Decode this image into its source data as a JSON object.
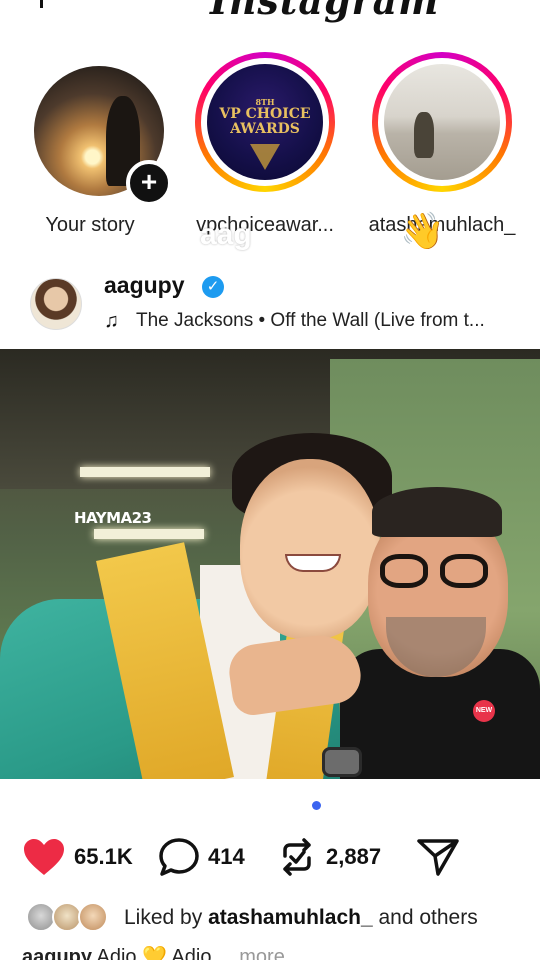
{
  "app": {
    "logo_text": "Instagram"
  },
  "stories": [
    {
      "name": "Your story",
      "has_ring": false,
      "has_add": true,
      "add_symbol": "+"
    },
    {
      "name": "vpchoiceawar...",
      "has_ring": true,
      "avatar_text": {
        "small": "8TH",
        "main": "VP CHOICE AWARDS"
      }
    },
    {
      "name": "atashamuhlach_",
      "has_ring": true
    }
  ],
  "overlay": {
    "text": "aag",
    "emoji": "👋"
  },
  "post": {
    "username": "aagupy",
    "verified": true,
    "verified_symbol": "✓",
    "music_icon": "♫",
    "music": "The Jacksons • Off the Wall (Live from t...",
    "image": {
      "watermark": "HAYMA23",
      "badge": "NEW"
    },
    "carousel": {
      "count": 1,
      "active": 1,
      "active_color": "#3b64f0"
    },
    "likes": "65.1K",
    "comments": "414",
    "reposts": "2,887",
    "liked_by": {
      "prefix": "Liked by ",
      "user": "atashamuhlach_",
      "suffix": " and others"
    },
    "caption": {
      "user": "aagupy",
      "text": " Adio 💛 Adio ...",
      "more": "more"
    }
  },
  "colors": {
    "heart": "#ed2b45",
    "verified": "#1d9bf0",
    "story_ring": "#ff0069"
  },
  "icons": [
    "heart-icon",
    "comment-icon",
    "repost-icon",
    "share-icon",
    "music-note-icon",
    "add-story-icon",
    "verified-badge-icon"
  ]
}
